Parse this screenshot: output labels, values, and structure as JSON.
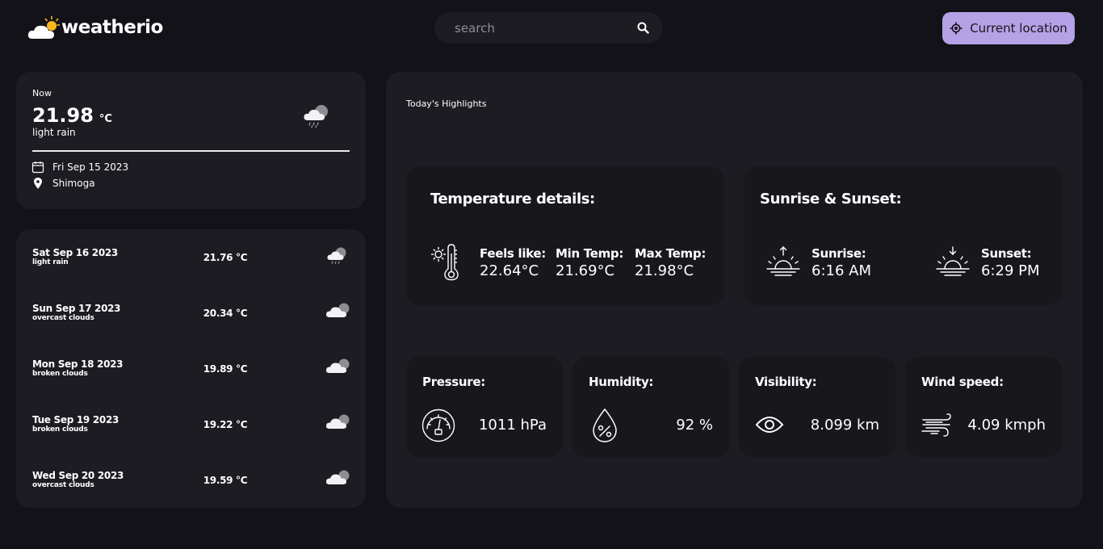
{
  "header": {
    "logo_text": "weatherio",
    "search_placeholder": "search",
    "current_location_label": "Current location"
  },
  "now": {
    "label": "Now",
    "temp": "21.98",
    "unit": "°C",
    "description": "light rain",
    "date": "Fri Sep 15 2023",
    "location": "Shimoga"
  },
  "forecast": [
    {
      "day": "Sat Sep 16 2023",
      "desc": "light rain",
      "temp": "21.76 °C",
      "icon": "rain-cloud-icon"
    },
    {
      "day": "Sun Sep 17 2023",
      "desc": "overcast clouds",
      "temp": "20.34 °C",
      "icon": "cloud-icon"
    },
    {
      "day": "Mon Sep 18 2023",
      "desc": "broken clouds",
      "temp": "19.89 °C",
      "icon": "cloud-icon"
    },
    {
      "day": "Tue Sep 19 2023",
      "desc": "broken clouds",
      "temp": "19.22 °C",
      "icon": "cloud-icon"
    },
    {
      "day": "Wed Sep 20 2023",
      "desc": "overcast clouds",
      "temp": "19.59 °C",
      "icon": "cloud-icon"
    }
  ],
  "highlights": {
    "title": "Today's Highlights",
    "temperature": {
      "title": "Temperature details:",
      "feels_like_label": "Feels like:",
      "feels_like": "22.64°C",
      "min_label": "Min Temp:",
      "min": "21.69°C",
      "max_label": "Max Temp:",
      "max": "21.98°C"
    },
    "sun": {
      "title": "Sunrise & Sunset:",
      "sunrise_label": "Sunrise:",
      "sunrise": "6:16 AM",
      "sunset_label": "Sunset:",
      "sunset": "6:29 PM"
    },
    "pressure": {
      "label": "Pressure:",
      "value": "1011 hPa"
    },
    "humidity": {
      "label": "Humidity:",
      "value": "92 %"
    },
    "visibility": {
      "label": "Visibility:",
      "value": "8.099 km"
    },
    "wind": {
      "label": "Wind speed:",
      "value": "4.09 kmph"
    }
  },
  "colors": {
    "background": "#131219",
    "card": "#1d1c22",
    "sub_card": "#18171c",
    "accent": "#b5a1e5",
    "sun": "#f5b91a"
  }
}
